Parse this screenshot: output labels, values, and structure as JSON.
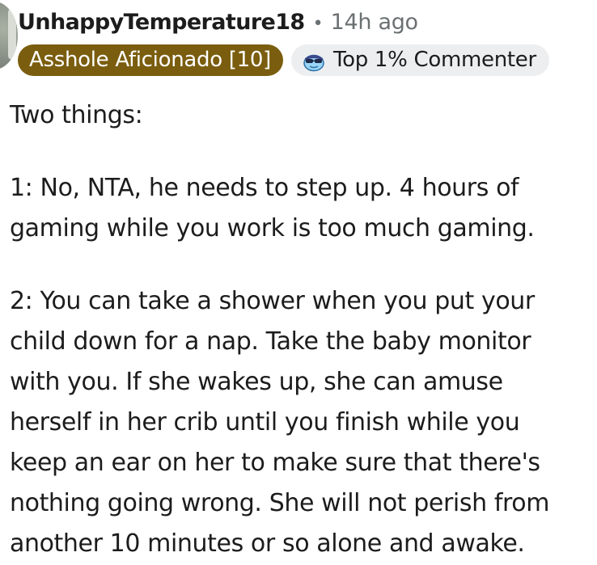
{
  "comment": {
    "username": "UnhappyTemperature18",
    "separator": "•",
    "timestamp": "14h ago",
    "flair": "Asshole Aficionado [10]",
    "badge": {
      "icon": "top-commenter-icon",
      "label": "Top 1% Commenter"
    },
    "paragraphs": [
      [
        "Two things:"
      ],
      [
        "1: No, NTA, he needs to step up. 4 hours of",
        "gaming while you work is too much gaming."
      ],
      [
        "2: You can take a shower when you put your",
        "child down for a nap. Take the baby monitor",
        "with you. If she wakes up, she can amuse",
        "herself in her crib until you finish while you",
        "keep an ear on her to make sure that there's",
        "nothing going wrong. She will not perish from",
        "another 10 minutes or so alone and awake."
      ]
    ]
  },
  "colors": {
    "flair_background": "#7a5d0e",
    "badge_background": "#eceef0",
    "meta_text": "#6b7173",
    "body_text": "#1c1c1c"
  }
}
